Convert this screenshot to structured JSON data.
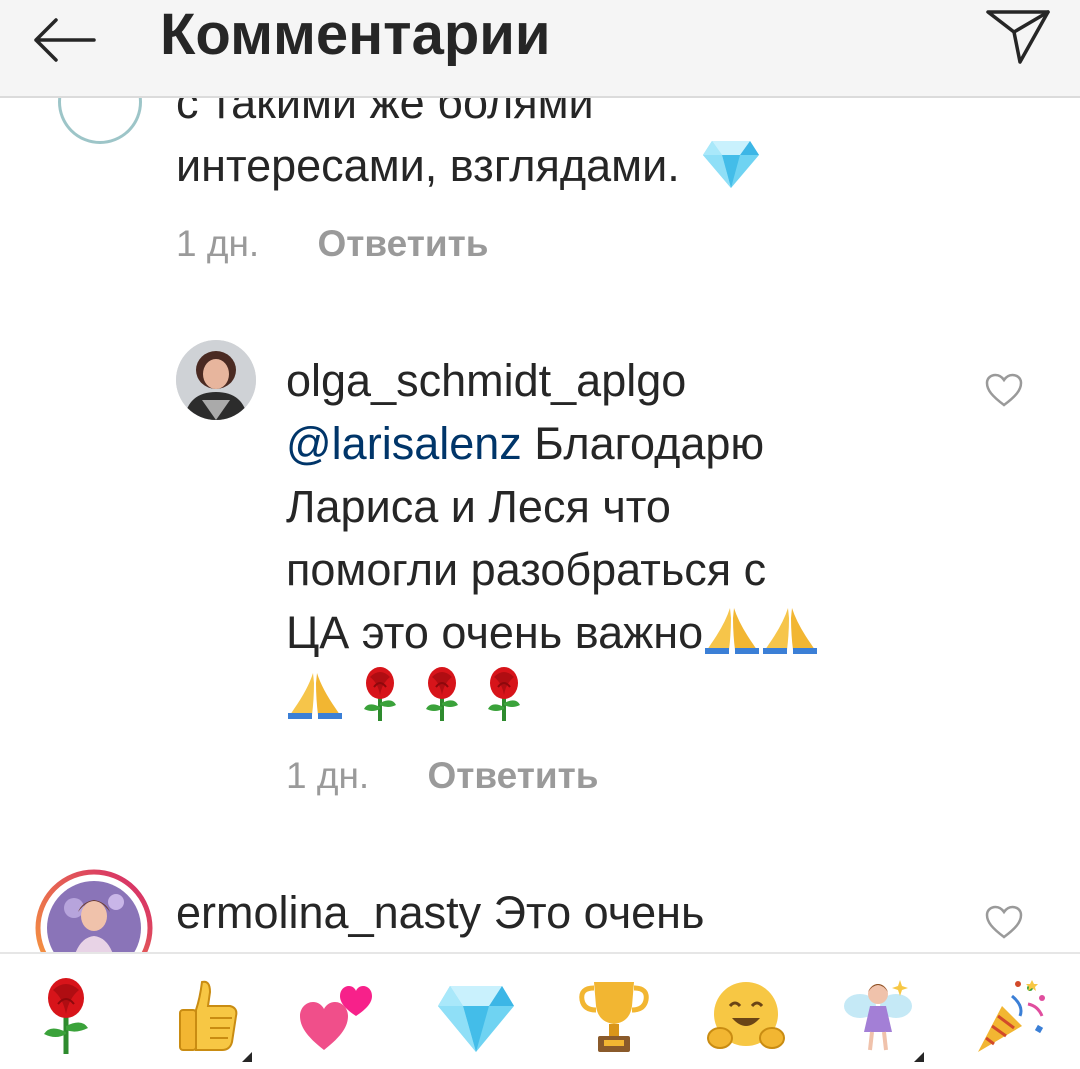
{
  "header": {
    "title": "Комментарии",
    "back_icon": "arrow-left-icon",
    "share_icon": "paper-plane-icon"
  },
  "comments": [
    {
      "text_lines": [
        "с такими же болями",
        "интересами,  взглядами."
      ],
      "trailing_emoji": "gem-icon",
      "time": "1 дн.",
      "reply_label": "Ответить"
    },
    {
      "username": "olga_schmidt_aplgo",
      "mention": "@larisalenz",
      "text_line1": "Благодарю",
      "text_lines": [
        "Лариса и Леся что",
        "помогли разобраться с",
        "ЦА это очень важно"
      ],
      "trailing_emojis": [
        "folded-hands-icon",
        "folded-hands-icon",
        "folded-hands-icon",
        "rose-icon",
        "rose-icon",
        "rose-icon"
      ],
      "time": "1 дн.",
      "reply_label": "Ответить",
      "like_icon": "heart-outline-icon"
    },
    {
      "username": "ermolina_nasty",
      "text": "Это очень",
      "like_icon": "heart-outline-icon"
    }
  ],
  "emoji_bar": [
    {
      "name": "rose-icon",
      "has_variants": false
    },
    {
      "name": "thumbs-up-icon",
      "has_variants": true
    },
    {
      "name": "two-hearts-icon",
      "has_variants": false
    },
    {
      "name": "gem-icon",
      "has_variants": false
    },
    {
      "name": "trophy-icon",
      "has_variants": false
    },
    {
      "name": "hugging-face-icon",
      "has_variants": false
    },
    {
      "name": "fairy-icon",
      "has_variants": true
    },
    {
      "name": "party-popper-icon",
      "has_variants": false
    }
  ],
  "colors": {
    "header_bg": "#f5f5f5",
    "text": "#262626",
    "meta": "#9a9a9a",
    "mention": "#003569",
    "story_ring_start": "#f9a23a",
    "story_ring_end": "#d3256c"
  }
}
